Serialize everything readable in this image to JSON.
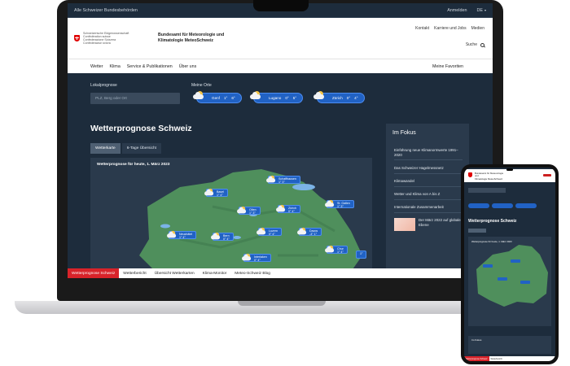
{
  "topbar": {
    "authorities": "Alle Schweizer Bundesbehörden",
    "login": "Anmelden",
    "language": "DE"
  },
  "header": {
    "confederation": [
      "Schweizerische Eidgenossenschaft",
      "Confédération suisse",
      "Confederazione Svizzera",
      "Confederaziun svizra"
    ],
    "agency_line1": "Bundesamt für Meteorologie und",
    "agency_line2": "Klimatologie MeteoSchweiz",
    "links": [
      "Kontakt",
      "Karriere und Jobs",
      "Medien"
    ],
    "search": "Suche"
  },
  "nav": {
    "items": [
      "Wetter",
      "Klima",
      "Service & Publikationen",
      "Über uns"
    ],
    "favorites": "Meine Favoriten"
  },
  "location": {
    "label": "Lokalprognose",
    "placeholder": "PLZ, Berg oder Ort"
  },
  "my_places": {
    "label": "Meine Orte",
    "places": [
      {
        "name": "Genf",
        "tmin": "1°",
        "tmax": "6°"
      },
      {
        "name": "Lugano",
        "tmin": "0°",
        "tmax": "5°"
      },
      {
        "name": "Zürich",
        "tmin": "0°",
        "tmax": "4°"
      }
    ]
  },
  "main": {
    "title": "Wetterprognose Schweiz",
    "tabs": [
      "Wetterkarte",
      "6-Tage Übersicht"
    ],
    "map_title": "Wetterprognose für heute, 1. März 2023",
    "cities": [
      {
        "name": "Schaffhausen",
        "temps": "1°  3°"
      },
      {
        "name": "Basel",
        "temps": "1°  4°"
      },
      {
        "name": "St. Gallen",
        "temps": "1°  3°"
      },
      {
        "name": "Olten",
        "temps": "1°  3°"
      },
      {
        "name": "Zürich",
        "temps": "0°  4°"
      },
      {
        "name": "Neuchâtel",
        "temps": "1°  4°"
      },
      {
        "name": "Bern",
        "temps": "0°  4°"
      },
      {
        "name": "Luzern",
        "temps": "0°  4°"
      },
      {
        "name": "Davos",
        "temps": "-3°  1°"
      },
      {
        "name": "Chur",
        "temps": "1°  4°"
      },
      {
        "name": "Interlaken",
        "temps": "0°  4°"
      },
      {
        "name": "Scuol",
        "temps": "1°"
      }
    ]
  },
  "focus": {
    "heading": "Im Fokus",
    "items": [
      "Einführung neue Klimanormwerte 1991–2020",
      "Das Schweizer Hagelmessnetz",
      "Klimawandel",
      "Wetter und Klima von A bis Z",
      "Internationale Zusammenarbeit"
    ],
    "teaser": "Der März 2022 auf globaler Ebene"
  },
  "bottom_tabs": [
    "Wetterprognose Schweiz",
    "Wetterbericht",
    "Übersicht Wetterkarten",
    "Klima-Monitor",
    "Meteo-Schweiz Blog"
  ],
  "phone": {
    "title": "Wetterprognose Schweiz",
    "map_title": "Wetterprognose für heute, 1. März 2023",
    "focus": "Im Fokus"
  },
  "colors": {
    "dark_bg": "#1d2c3c",
    "panel_bg": "#2a3a4c",
    "accent_blue": "#2162c4",
    "active_red": "#d8232a",
    "map_green": "#4f8f5c",
    "lake": "#7bb3e6"
  }
}
